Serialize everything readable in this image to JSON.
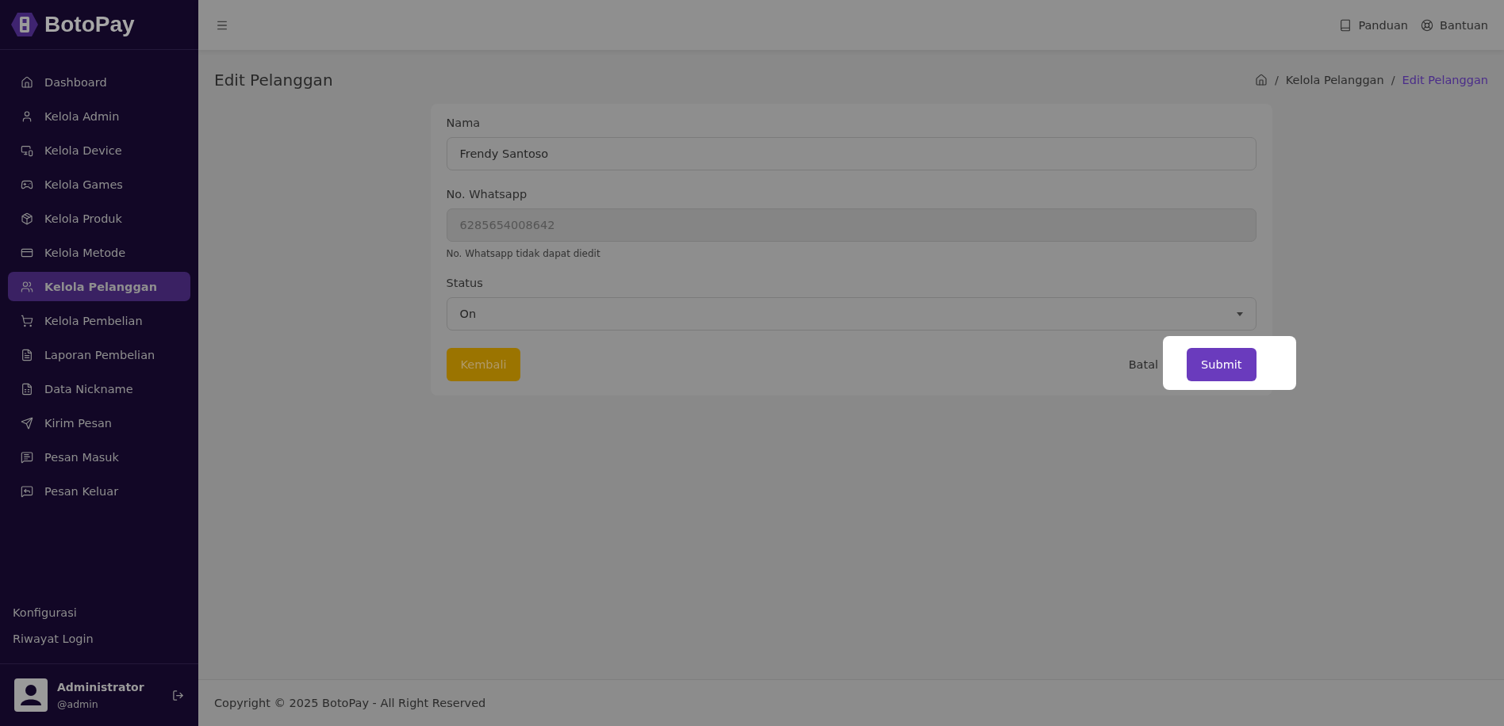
{
  "brand": "BotoPay",
  "sidebar": {
    "items": [
      {
        "label": "Dashboard",
        "selected": false
      },
      {
        "label": "Kelola Admin",
        "selected": false
      },
      {
        "label": "Kelola Device",
        "selected": false
      },
      {
        "label": "Kelola Games",
        "selected": false
      },
      {
        "label": "Kelola Produk",
        "selected": false
      },
      {
        "label": "Kelola Metode",
        "selected": false
      },
      {
        "label": "Kelola Pelanggan",
        "selected": true
      },
      {
        "label": "Kelola Pembelian",
        "selected": false
      },
      {
        "label": "Laporan Pembelian",
        "selected": false
      },
      {
        "label": "Data Nickname",
        "selected": false
      },
      {
        "label": "Kirim Pesan",
        "selected": false
      },
      {
        "label": "Pesan Masuk",
        "selected": false
      },
      {
        "label": "Pesan Keluar",
        "selected": false
      }
    ],
    "bottom_links": [
      "Konfigurasi",
      "Riwayat Login"
    ],
    "user": {
      "name": "Administrator",
      "handle": "@admin"
    }
  },
  "topbar": {
    "links": [
      "Panduan",
      "Bantuan"
    ]
  },
  "page": {
    "title": "Edit Pelanggan",
    "breadcrumb": [
      {
        "separator": "/",
        "label": "Kelola Pelanggan",
        "current": false
      },
      {
        "separator": "/",
        "label": "Edit Pelanggan",
        "current": true
      }
    ]
  },
  "form": {
    "fields": [
      {
        "kind": "text",
        "label": "Nama",
        "value": "Frendy Santoso",
        "disabled": false
      },
      {
        "kind": "text",
        "label": "No. Whatsapp",
        "value": "6285654008642",
        "disabled": true,
        "help": "No. Whatsapp tidak dapat diedit"
      },
      {
        "kind": "select",
        "label": "Status",
        "value": "On",
        "disabled": false
      }
    ],
    "back_button": "Kembali",
    "cancel_button": "Batal",
    "submit_button": "Submit"
  },
  "footer": "Copyright © 2025 BotoPay - All Right Reserved"
}
